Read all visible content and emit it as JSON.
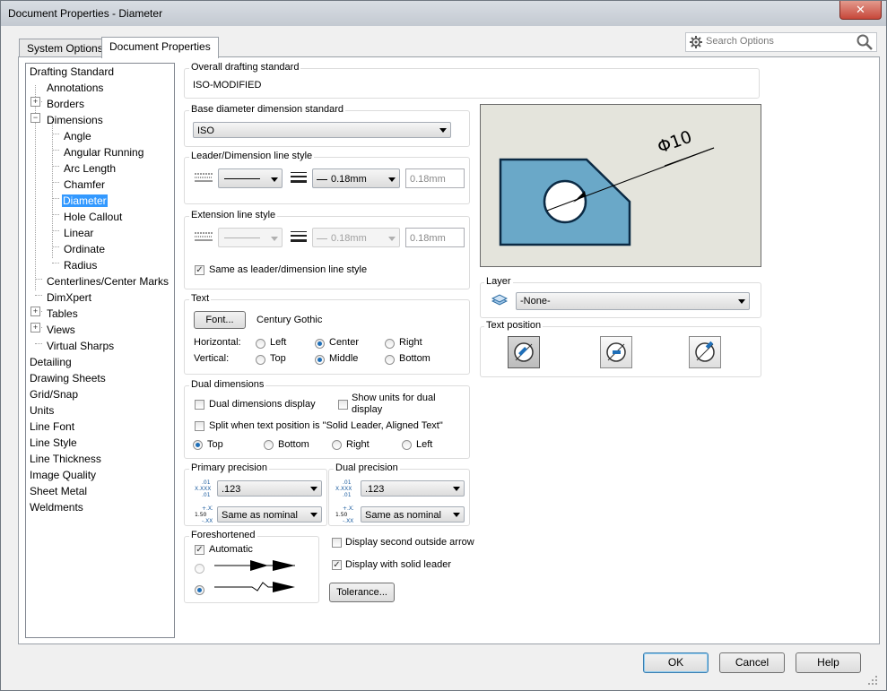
{
  "window": {
    "title": "Document Properties - Diameter",
    "close_glyph": "✕"
  },
  "tabs": [
    {
      "label": "System Options"
    },
    {
      "label": "Document Properties"
    }
  ],
  "search": {
    "placeholder": "Search Options"
  },
  "tree": {
    "items": [
      {
        "label": "Drafting Standard"
      },
      {
        "label": "Annotations"
      },
      {
        "label": "Borders"
      },
      {
        "label": "Dimensions"
      },
      {
        "label": "Angle"
      },
      {
        "label": "Angular Running"
      },
      {
        "label": "Arc Length"
      },
      {
        "label": "Chamfer"
      },
      {
        "label": "Diameter"
      },
      {
        "label": "Hole Callout"
      },
      {
        "label": "Linear"
      },
      {
        "label": "Ordinate"
      },
      {
        "label": "Radius"
      },
      {
        "label": "Centerlines/Center Marks"
      },
      {
        "label": "DimXpert"
      },
      {
        "label": "Tables"
      },
      {
        "label": "Views"
      },
      {
        "label": "Virtual Sharps"
      },
      {
        "label": "Detailing"
      },
      {
        "label": "Drawing Sheets"
      },
      {
        "label": "Grid/Snap"
      },
      {
        "label": "Units"
      },
      {
        "label": "Line Font"
      },
      {
        "label": "Line Style"
      },
      {
        "label": "Line Thickness"
      },
      {
        "label": "Image Quality"
      },
      {
        "label": "Sheet Metal"
      },
      {
        "label": "Weldments"
      }
    ],
    "selected": "Diameter"
  },
  "overall": {
    "title": "Overall drafting standard",
    "value": "ISO-MODIFIED"
  },
  "base_std": {
    "title": "Base diameter dimension standard",
    "value": "ISO"
  },
  "leader_style": {
    "title": "Leader/Dimension line style",
    "thickness": "0.18mm",
    "custom": "0.18mm"
  },
  "ext_style": {
    "title": "Extension line style",
    "thickness": "0.18mm",
    "custom": "0.18mm",
    "same_label": "Same as leader/dimension line style"
  },
  "text": {
    "title": "Text",
    "font_button": "Font...",
    "font_name": "Century Gothic",
    "horizontal_label": "Horizontal:",
    "vertical_label": "Vertical:",
    "h_options": [
      "Left",
      "Center",
      "Right"
    ],
    "v_options": [
      "Top",
      "Middle",
      "Bottom"
    ]
  },
  "dual": {
    "title": "Dual dimensions",
    "display": "Dual dimensions display",
    "show_units": "Show units for dual display",
    "split": "Split when text position is \"Solid Leader, Aligned Text\"",
    "positions": [
      "Top",
      "Bottom",
      "Right",
      "Left"
    ]
  },
  "primary_precision": {
    "title": "Primary precision",
    "value": ".123",
    "tolerance": "Same as nominal",
    "icon1": "X.XXX .01 .01",
    "icon2": "1.50 +.XX -.XX"
  },
  "dual_precision": {
    "title": "Dual precision",
    "value": ".123",
    "tolerance": "Same as nominal"
  },
  "foreshortened": {
    "title": "Foreshortened",
    "automatic": "Automatic"
  },
  "options": {
    "second_arrow": "Display second outside arrow",
    "solid_leader": "Display with solid leader",
    "tolerance_button": "Tolerance..."
  },
  "preview": {
    "dim_text": "Φ10"
  },
  "layer": {
    "title": "Layer",
    "value": "-None-"
  },
  "text_position": {
    "title": "Text position"
  },
  "footer": {
    "ok": "OK",
    "cancel": "Cancel",
    "help": "Help"
  },
  "colors": {
    "part_fill": "#6aa8c8",
    "part_stroke": "#0b2a44",
    "selection": "#3399ff"
  }
}
